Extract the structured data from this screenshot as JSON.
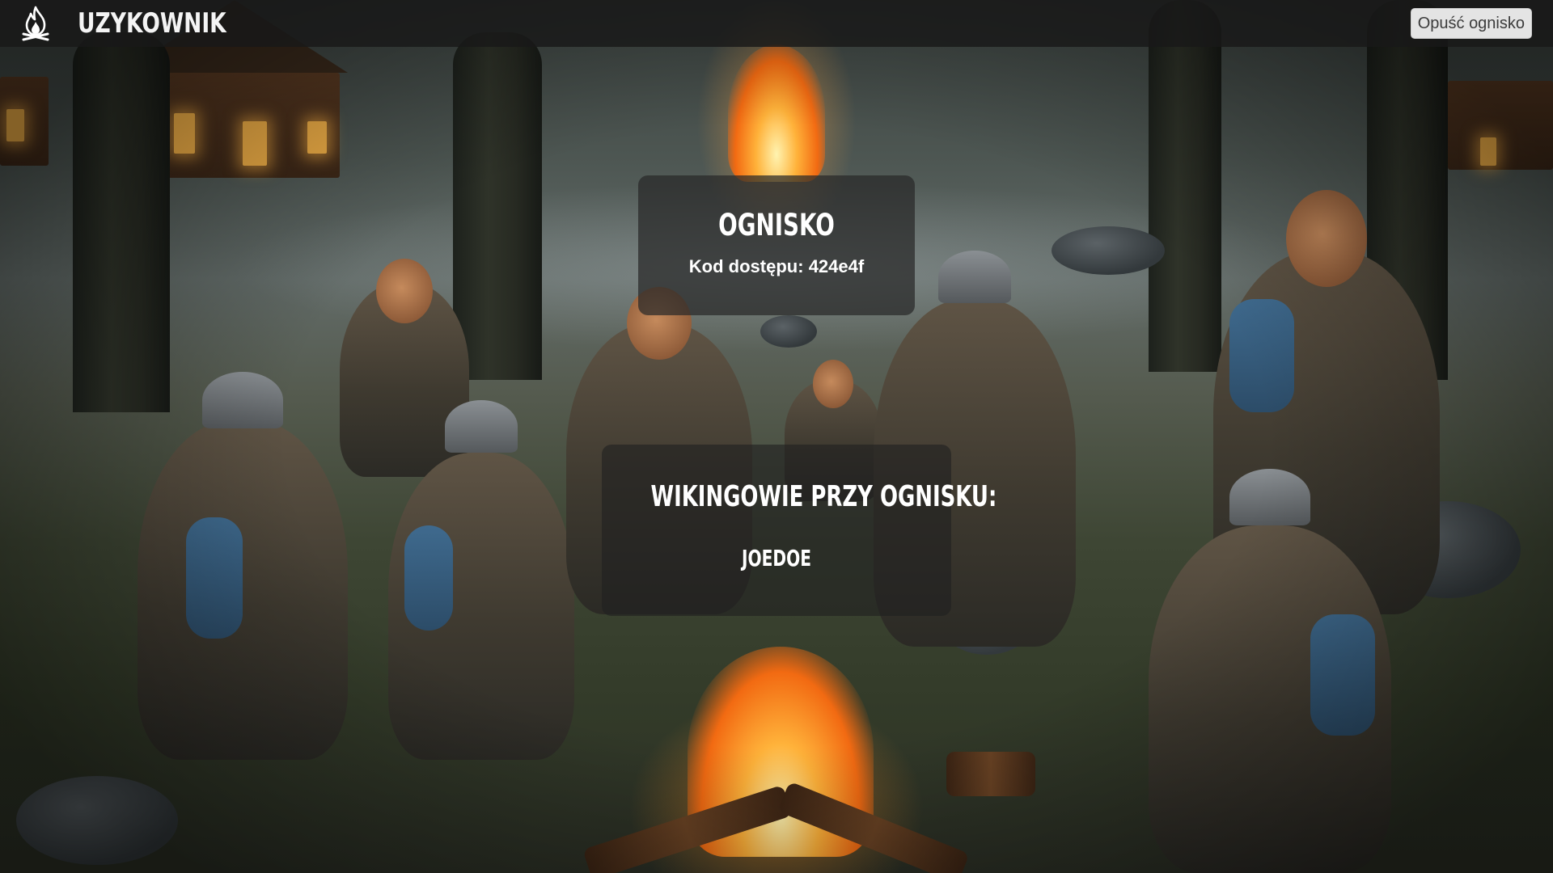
{
  "header": {
    "username": "UZYKOWNIK",
    "logo_icon": "campfire-icon",
    "leave_button_label": "Opuść ognisko"
  },
  "fire_panel": {
    "title": "OGNISKO",
    "access_code_label": "Kod dostępu:",
    "access_code": "424e4f"
  },
  "vikings_panel": {
    "heading": "WIKINGOWIE PRZY OGNISKU:",
    "members": [
      "JOEDOE"
    ]
  },
  "background": {
    "description_icon": "viking-campfire-illustration"
  }
}
